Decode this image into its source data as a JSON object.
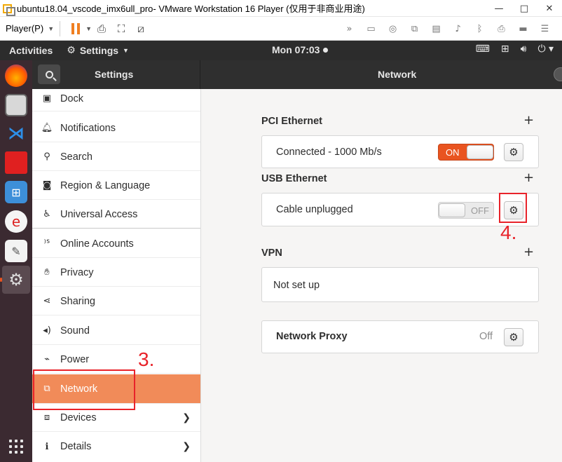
{
  "vmware": {
    "window_title": "ubuntu18.04_vscode_imx6ull_pro- VMware Workstation 16 Player (仅用于非商业用途)",
    "minimize": "—",
    "maximize": "□",
    "close": "✕",
    "player_menu": "Player(P)"
  },
  "ubuntu_bar": {
    "activities": "Activities",
    "app_menu": "Settings",
    "clock": "Mon 07:03"
  },
  "settings": {
    "sidebar_title": "Settings",
    "page_title": "Network",
    "sidebar_items": [
      {
        "label": "Dock",
        "icon": "dock-icon"
      },
      {
        "label": "Notifications",
        "icon": "bell-icon"
      },
      {
        "label": "Search",
        "icon": "search-icon"
      },
      {
        "label": "Region & Language",
        "icon": "camera-icon"
      },
      {
        "label": "Universal Access",
        "icon": "accessibility-icon"
      },
      {
        "label": "Online Accounts",
        "icon": "online-accounts-icon"
      },
      {
        "label": "Privacy",
        "icon": "hand-icon"
      },
      {
        "label": "Sharing",
        "icon": "share-icon"
      },
      {
        "label": "Sound",
        "icon": "speaker-icon"
      },
      {
        "label": "Power",
        "icon": "power-plug-icon"
      },
      {
        "label": "Network",
        "icon": "network-icon",
        "active": true
      },
      {
        "label": "Devices",
        "icon": "devices-icon"
      },
      {
        "label": "Details",
        "icon": "info-icon"
      }
    ]
  },
  "network": {
    "pci": {
      "title": "PCI Ethernet",
      "status": "Connected - 1000 Mb/s",
      "switch_label": "ON"
    },
    "usb": {
      "title": "USB Ethernet",
      "status": "Cable unplugged",
      "switch_label": "OFF"
    },
    "vpn": {
      "title": "VPN",
      "status": "Not set up"
    },
    "proxy": {
      "title": "Network Proxy",
      "status": "Off"
    }
  },
  "annotations": {
    "step3": "3.",
    "step4": "4."
  },
  "colors": {
    "accent": "#e95420",
    "sidebar_active": "#f18b59",
    "annotation": "#e8232a"
  }
}
